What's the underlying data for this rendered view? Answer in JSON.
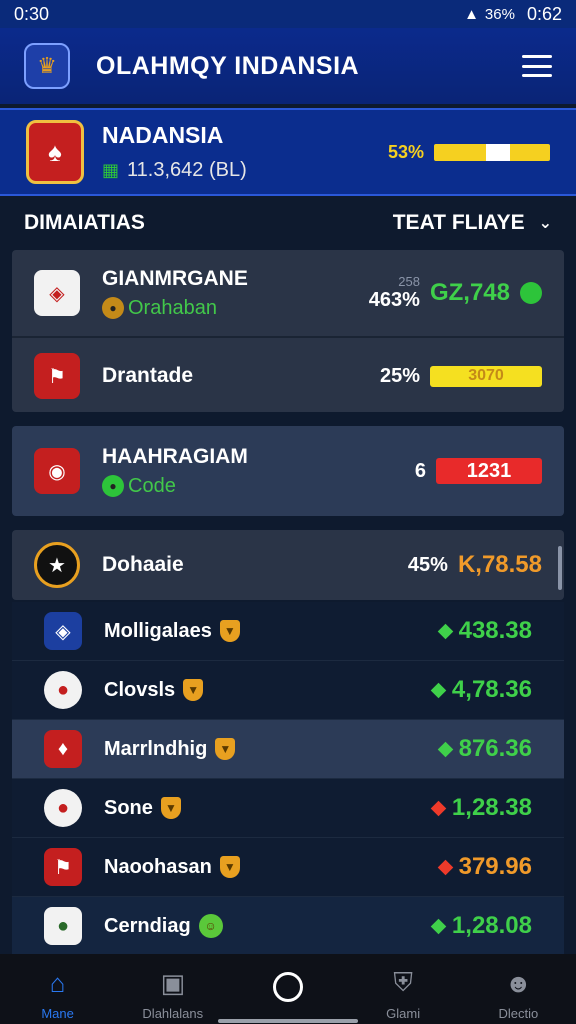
{
  "status_bar": {
    "time": "0:30",
    "battery": "36%",
    "clock": "0:62"
  },
  "header": {
    "title": "OLAHMQY INDANSIA"
  },
  "featured": {
    "name": "NADANSIA",
    "subtitle": "11.3,642 (BL)",
    "percent": "53%",
    "bar_level": 1.0
  },
  "section": {
    "title": "DIMAIATIAS",
    "filter_label": "TEAT FLIAYE"
  },
  "cards": [
    {
      "name": "GIANMRGANE",
      "subtitle": "Orahaban",
      "small_label": "258",
      "percent": "463%",
      "value": "GZ,748"
    },
    {
      "name": "Drantade",
      "percent": "25%",
      "bar_value": "3070"
    },
    {
      "name": "HAAHRAGIAM",
      "subtitle": "Code",
      "percent": "6",
      "bar_value": "1231"
    },
    {
      "name": "Dohaaie",
      "percent": "45%",
      "value": "K,78.58"
    }
  ],
  "list": [
    {
      "name": "Molligalaes",
      "value": "438.38",
      "trend": "up"
    },
    {
      "name": "Clovsls",
      "value": "4,78.36",
      "trend": "up"
    },
    {
      "name": "Marrlndhig",
      "value": "876.36",
      "trend": "up"
    },
    {
      "name": "Sone",
      "value": "1,28.38",
      "trend": "down"
    },
    {
      "name": "Naoohasan",
      "value": "379.96",
      "trend": "down"
    },
    {
      "name": "Cerndiag",
      "value": "1,28.08",
      "trend": "up"
    }
  ],
  "nav": [
    {
      "label": "Mane",
      "icon": "home-icon"
    },
    {
      "label": "Dlahlalans",
      "icon": "briefcase-icon"
    },
    {
      "label": "",
      "icon": "circle-icon"
    },
    {
      "label": "Glami",
      "icon": "shield-icon"
    },
    {
      "label": "Dlectio",
      "icon": "person-icon"
    }
  ],
  "colors": {
    "accent": "#0b2d8e",
    "up": "#3fd04a",
    "down": "#ee3a2a",
    "highlight": "#f5e020"
  }
}
